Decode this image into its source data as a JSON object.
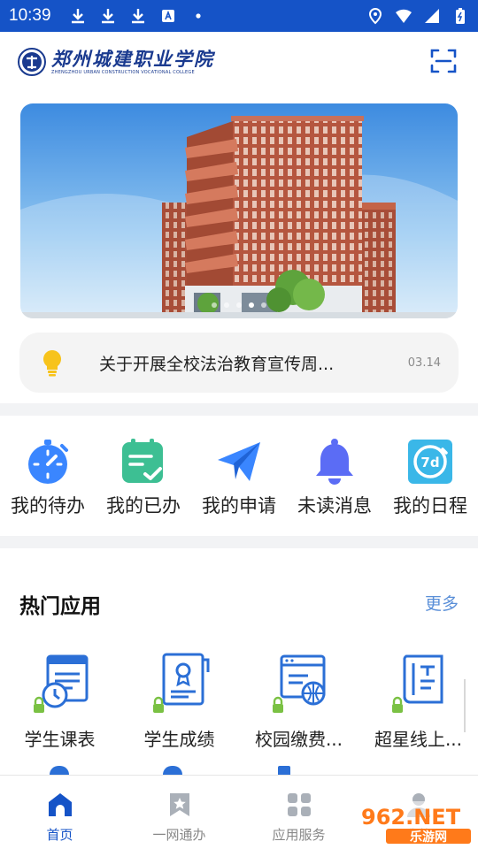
{
  "status": {
    "time": "10:39"
  },
  "header": {
    "logo_cn": "郑州城建职业学院",
    "logo_en": "ZHENGZHOU URBAN CONSTRUCTION VOCATIONAL COLLEGE"
  },
  "notice": {
    "text": "关于开展全校法治教育宣传周...",
    "date": "03.14"
  },
  "quick_actions": [
    {
      "label": "我的待办",
      "icon": "stopwatch-icon"
    },
    {
      "label": "我的已办",
      "icon": "clipboard-check-icon"
    },
    {
      "label": "我的申请",
      "icon": "paper-plane-icon"
    },
    {
      "label": "未读消息",
      "icon": "bell-icon"
    },
    {
      "label": "我的日程",
      "icon": "7d-calendar-icon"
    }
  ],
  "hot_apps": {
    "title": "热门应用",
    "more": "更多",
    "items": [
      {
        "label": "学生课表",
        "icon": "schedule-icon"
      },
      {
        "label": "学生成绩",
        "icon": "certificate-icon"
      },
      {
        "label": "校园缴费...",
        "icon": "web-payment-icon"
      },
      {
        "label": "超星线上...",
        "icon": "book-icon"
      }
    ]
  },
  "bottom_nav": [
    {
      "label": "首页",
      "icon": "home-icon",
      "active": true
    },
    {
      "label": "一网通办",
      "icon": "bookmark-star-icon",
      "active": false
    },
    {
      "label": "应用服务",
      "icon": "grid-icon",
      "active": false
    },
    {
      "label": "我的",
      "icon": "user-icon",
      "active": false
    }
  ],
  "watermark": {
    "text": "962.NET",
    "sub": "乐游网"
  },
  "colors": {
    "primary": "#1553c7",
    "accent": "#3a86ff",
    "more_link": "#5a8fd8",
    "lock": "#7ac143"
  }
}
